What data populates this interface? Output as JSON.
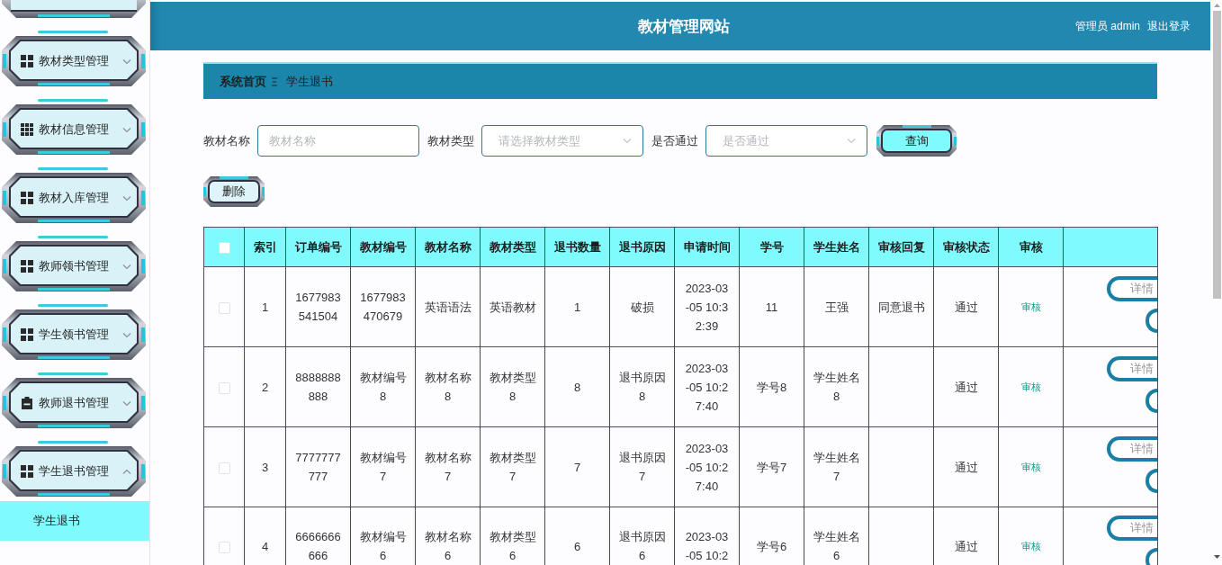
{
  "sidebar": {
    "items": [
      {
        "label": "教材类型管理",
        "expanded": false
      },
      {
        "label": "教材信息管理",
        "expanded": false
      },
      {
        "label": "教材入库管理",
        "expanded": false
      },
      {
        "label": "教师领书管理",
        "expanded": false
      },
      {
        "label": "学生领书管理",
        "expanded": false
      },
      {
        "label": "教师退书管理",
        "expanded": false
      },
      {
        "label": "学生退书管理",
        "expanded": true,
        "children": [
          {
            "label": "学生退书",
            "selected": true
          }
        ]
      }
    ]
  },
  "header": {
    "title": "教材管理网站",
    "user": "管理员 admin",
    "logout": "退出登录"
  },
  "breadcrumb": {
    "home": "系统首页",
    "current": "学生退书"
  },
  "search": {
    "fields": [
      {
        "kind": "input",
        "label": "教材名称",
        "placeholder": "教材名称"
      },
      {
        "kind": "select",
        "label": "教材类型",
        "placeholder": "请选择教材类型"
      },
      {
        "kind": "select",
        "label": "是否通过",
        "placeholder": "是否通过"
      }
    ],
    "button": "查询"
  },
  "toolbar": {
    "delete_button": "删除"
  },
  "table": {
    "select_all_checked": false,
    "columns": [
      "索引",
      "订单编号",
      "教材编号",
      "教材名称",
      "教材类型",
      "退书数量",
      "退书原因",
      "申请时间",
      "学号",
      "学生姓名",
      "审核回复",
      "审核状态",
      "审核"
    ],
    "rows": [
      {
        "checked": false,
        "index": "1",
        "order_no": "1677983541504",
        "book_no": "1677983470679",
        "book_name": "英语语法",
        "book_type": "英语教材",
        "quantity": "1",
        "reason": "破损",
        "applied_at": "2023-03-05 10:32:39",
        "student_no": "11",
        "student_name": "王强",
        "reply": "同意退书",
        "status": "通过",
        "review": "审核",
        "details": "详情"
      },
      {
        "checked": false,
        "index": "2",
        "order_no": "8888888888",
        "book_no": "教材编号8",
        "book_name": "教材名称8",
        "book_type": "教材类型8",
        "quantity": "8",
        "reason": "退书原因8",
        "applied_at": "2023-03-05 10:27:40",
        "student_no": "学号8",
        "student_name": "学生姓名8",
        "status": "通过",
        "review": "审核",
        "details": "详情"
      },
      {
        "checked": false,
        "index": "3",
        "order_no": "7777777777",
        "book_no": "教材编号7",
        "book_name": "教材名称7",
        "book_type": "教材类型7",
        "quantity": "7",
        "reason": "退书原因7",
        "applied_at": "2023-03-05 10:27:40",
        "student_no": "学号7",
        "student_name": "学生姓名7",
        "status": "通过",
        "review": "审核",
        "details": "详情"
      },
      {
        "checked": false,
        "index": "4",
        "order_no": "6666666666",
        "book_no": "教材编号6",
        "book_name": "教材名称6",
        "book_type": "教材类型6",
        "quantity": "6",
        "reason": "退书原因6",
        "applied_at": "2023-03-05 10:2",
        "student_no": "学号6",
        "student_name": "学生姓名6",
        "status": "通过",
        "review": "审核",
        "details": "详情"
      }
    ]
  }
}
